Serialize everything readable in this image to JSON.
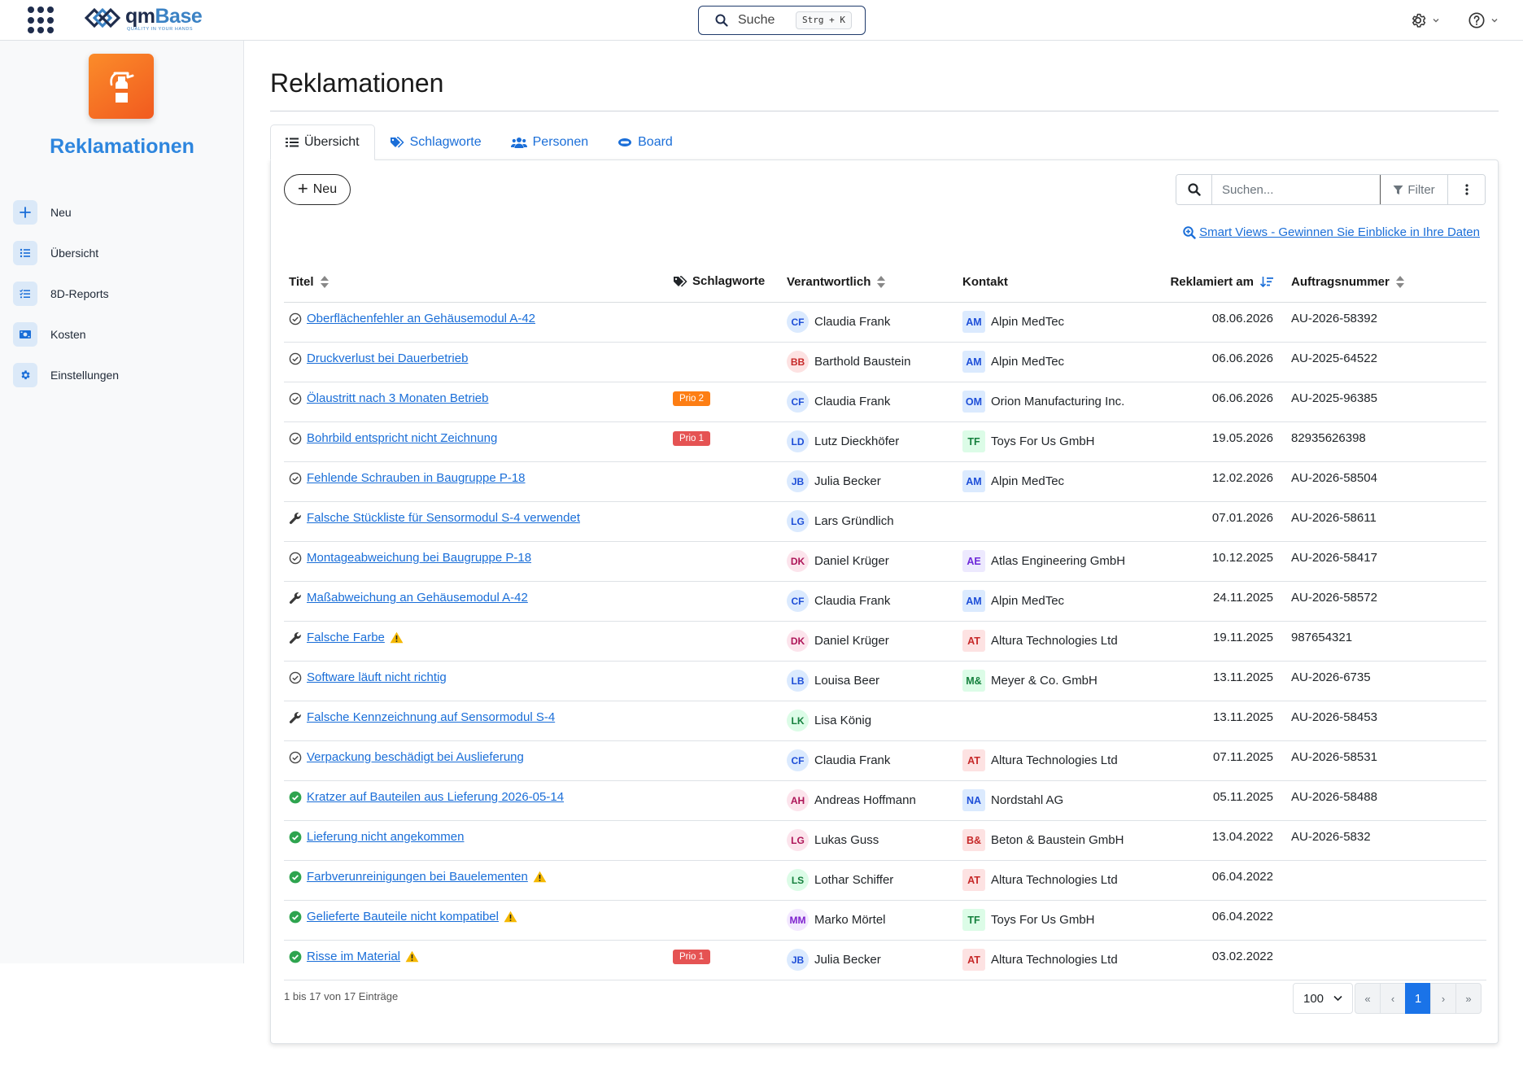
{
  "topbar": {
    "logo_brand_prefix": "qm",
    "logo_brand_suffix": "Base",
    "logo_tagline": "QUALITY IN YOUR HANDS",
    "search_label": "Suche",
    "search_shortcut": "Strg + K"
  },
  "sidebar": {
    "app_title": "Reklamationen",
    "items": [
      {
        "label": "Neu",
        "icon": "plus-icon"
      },
      {
        "label": "Übersicht",
        "icon": "list-icon"
      },
      {
        "label": "8D-Reports",
        "icon": "checklist-icon"
      },
      {
        "label": "Kosten",
        "icon": "money-icon"
      },
      {
        "label": "Einstellungen",
        "icon": "gear-icon"
      }
    ]
  },
  "main": {
    "title": "Reklamationen",
    "tabs": [
      {
        "label": "Übersicht",
        "icon": "list-icon",
        "active": true
      },
      {
        "label": "Schlagworte",
        "icon": "tags-icon",
        "active": false
      },
      {
        "label": "Personen",
        "icon": "users-icon",
        "active": false
      },
      {
        "label": "Board",
        "icon": "board-icon",
        "active": false
      }
    ],
    "new_button": "Neu",
    "search_placeholder": "Suchen...",
    "filter_label": "Filter",
    "smart_views_link": "Smart Views - Gewinnen Sie Einblicke in Ihre Daten",
    "columns": {
      "title": "Titel",
      "tags": "Schlagworte",
      "responsible": "Verantwortlich",
      "contact": "Kontakt",
      "date": "Reklamiert am",
      "order": "Auftragsnummer"
    },
    "rows": [
      {
        "status": "open",
        "title": "Oberflächenfehler an Gehäusemodul A-42",
        "warn": false,
        "prio": "",
        "person_initials": "CF",
        "person": "Claudia Frank",
        "contact_initials": "AM",
        "contact": "Alpin MedTec",
        "date": "08.06.2026",
        "order": "AU-2026-58392"
      },
      {
        "status": "open",
        "title": "Druckverlust bei Dauerbetrieb",
        "warn": false,
        "prio": "",
        "person_initials": "BB",
        "person": "Barthold Baustein",
        "contact_initials": "AM",
        "contact": "Alpin MedTec",
        "date": "06.06.2026",
        "order": "AU-2025-64522"
      },
      {
        "status": "open",
        "title": "Ölaustritt nach 3 Monaten Betrieb",
        "warn": false,
        "prio": "Prio 2",
        "person_initials": "CF",
        "person": "Claudia Frank",
        "contact_initials": "OM",
        "contact": "Orion Manufacturing Inc.",
        "date": "06.06.2026",
        "order": "AU-2025-96385"
      },
      {
        "status": "open",
        "title": "Bohrbild entspricht nicht Zeichnung",
        "warn": false,
        "prio": "Prio 1",
        "person_initials": "LD",
        "person": "Lutz Dieckhöfer",
        "contact_initials": "TF",
        "contact": "Toys For Us GmbH",
        "date": "19.05.2026",
        "order": "82935626398"
      },
      {
        "status": "open",
        "title": "Fehlende Schrauben in Baugruppe P-18",
        "warn": false,
        "prio": "",
        "person_initials": "JB",
        "person": "Julia Becker",
        "contact_initials": "AM",
        "contact": "Alpin MedTec",
        "date": "12.02.2026",
        "order": "AU-2026-58504"
      },
      {
        "status": "wrench",
        "title": "Falsche Stückliste für Sensormodul S-4 verwendet",
        "warn": false,
        "prio": "",
        "person_initials": "LG",
        "person": "Lars Gründlich",
        "contact_initials": "",
        "contact": "",
        "date": "07.01.2026",
        "order": "AU-2026-58611"
      },
      {
        "status": "open",
        "title": "Montageabweichung bei Baugruppe P-18",
        "warn": false,
        "prio": "",
        "person_initials": "DK",
        "person": "Daniel Krüger",
        "contact_initials": "AE",
        "contact": "Atlas Engineering GmbH",
        "date": "10.12.2025",
        "order": "AU-2026-58417"
      },
      {
        "status": "wrench",
        "title": "Maßabweichung an Gehäusemodul A-42",
        "warn": false,
        "prio": "",
        "person_initials": "CF",
        "person": "Claudia Frank",
        "contact_initials": "AM",
        "contact": "Alpin MedTec",
        "date": "24.11.2025",
        "order": "AU-2026-58572"
      },
      {
        "status": "wrench",
        "title": "Falsche Farbe",
        "warn": true,
        "prio": "",
        "person_initials": "DK",
        "person": "Daniel Krüger",
        "contact_initials": "AT",
        "contact": "Altura Technologies Ltd",
        "date": "19.11.2025",
        "order": "987654321"
      },
      {
        "status": "open",
        "title": "Software läuft nicht richtig",
        "warn": false,
        "prio": "",
        "person_initials": "LB",
        "person": "Louisa Beer",
        "contact_initials": "M&",
        "contact": "Meyer & Co. GmbH",
        "date": "13.11.2025",
        "order": "AU-2026-6735"
      },
      {
        "status": "wrench",
        "title": "Falsche Kennzeichnung auf Sensormodul S-4",
        "warn": false,
        "prio": "",
        "person_initials": "LK",
        "person": "Lisa König",
        "contact_initials": "",
        "contact": "",
        "date": "13.11.2025",
        "order": "AU-2026-58453"
      },
      {
        "status": "open",
        "title": "Verpackung beschädigt bei Auslieferung",
        "warn": false,
        "prio": "",
        "person_initials": "CF",
        "person": "Claudia Frank",
        "contact_initials": "AT",
        "contact": "Altura Technologies Ltd",
        "date": "07.11.2025",
        "order": "AU-2026-58531"
      },
      {
        "status": "done",
        "title": "Kratzer auf Bauteilen aus Lieferung 2026-05-14",
        "warn": false,
        "prio": "",
        "person_initials": "AH",
        "person": "Andreas Hoffmann",
        "contact_initials": "NA",
        "contact": "Nordstahl AG",
        "date": "05.11.2025",
        "order": "AU-2026-58488"
      },
      {
        "status": "done",
        "title": "Lieferung nicht angekommen",
        "warn": false,
        "prio": "",
        "person_initials": "LG",
        "person": "Lukas Guss",
        "contact_initials": "B&",
        "contact": "Beton & Baustein GmbH",
        "date": "13.04.2022",
        "order": "AU-2026-5832"
      },
      {
        "status": "done",
        "title": "Farbverunreinigungen bei Bauelementen",
        "warn": true,
        "prio": "",
        "person_initials": "LS",
        "person": "Lothar Schiffer",
        "contact_initials": "AT",
        "contact": "Altura Technologies Ltd",
        "date": "06.04.2022",
        "order": ""
      },
      {
        "status": "done",
        "title": "Gelieferte Bauteile nicht kompatibel",
        "warn": true,
        "prio": "",
        "person_initials": "MM",
        "person": "Marko Mörtel",
        "contact_initials": "TF",
        "contact": "Toys For Us GmbH",
        "date": "06.04.2022",
        "order": ""
      },
      {
        "status": "done",
        "title": "Risse im Material",
        "warn": true,
        "prio": "Prio 1",
        "person_initials": "JB",
        "person": "Julia Becker",
        "contact_initials": "AT",
        "contact": "Altura Technologies Ltd",
        "date": "03.02.2022",
        "order": ""
      }
    ],
    "footer_info": "1 bis 17 von 17 Einträge",
    "page_size": "100",
    "pager": {
      "first": "«",
      "prev": "‹",
      "current": "1",
      "next": "›",
      "last": "»"
    }
  },
  "colors": {
    "accent": "#2e86de",
    "link": "#1a6ed8",
    "prio_1": "#e55353",
    "prio_2": "#fd7e14",
    "done_green": "#2ea44f",
    "warn_yellow": "#f5b800",
    "app_icon_orange": "#f36b21"
  }
}
